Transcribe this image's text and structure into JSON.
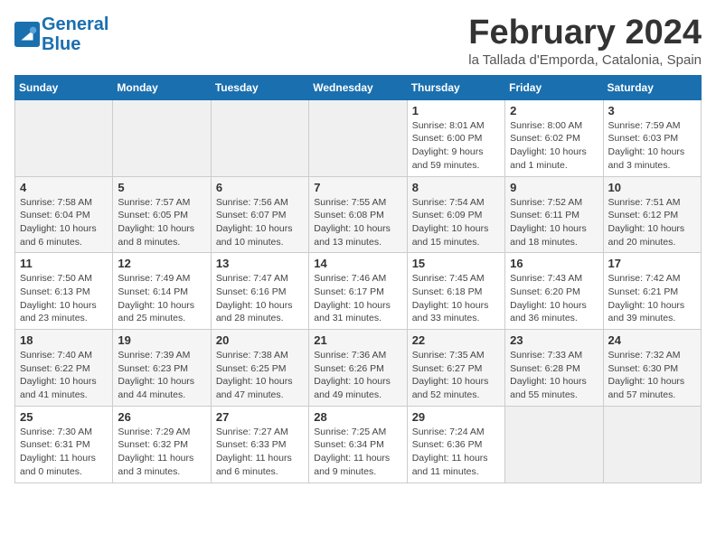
{
  "header": {
    "logo_line1": "General",
    "logo_line2": "Blue",
    "month_title": "February 2024",
    "location": "la Tallada d'Emporda, Catalonia, Spain"
  },
  "weekdays": [
    "Sunday",
    "Monday",
    "Tuesday",
    "Wednesday",
    "Thursday",
    "Friday",
    "Saturday"
  ],
  "weeks": [
    [
      {
        "day": "",
        "info": ""
      },
      {
        "day": "",
        "info": ""
      },
      {
        "day": "",
        "info": ""
      },
      {
        "day": "",
        "info": ""
      },
      {
        "day": "1",
        "info": "Sunrise: 8:01 AM\nSunset: 6:00 PM\nDaylight: 9 hours and 59 minutes."
      },
      {
        "day": "2",
        "info": "Sunrise: 8:00 AM\nSunset: 6:02 PM\nDaylight: 10 hours and 1 minute."
      },
      {
        "day": "3",
        "info": "Sunrise: 7:59 AM\nSunset: 6:03 PM\nDaylight: 10 hours and 3 minutes."
      }
    ],
    [
      {
        "day": "4",
        "info": "Sunrise: 7:58 AM\nSunset: 6:04 PM\nDaylight: 10 hours and 6 minutes."
      },
      {
        "day": "5",
        "info": "Sunrise: 7:57 AM\nSunset: 6:05 PM\nDaylight: 10 hours and 8 minutes."
      },
      {
        "day": "6",
        "info": "Sunrise: 7:56 AM\nSunset: 6:07 PM\nDaylight: 10 hours and 10 minutes."
      },
      {
        "day": "7",
        "info": "Sunrise: 7:55 AM\nSunset: 6:08 PM\nDaylight: 10 hours and 13 minutes."
      },
      {
        "day": "8",
        "info": "Sunrise: 7:54 AM\nSunset: 6:09 PM\nDaylight: 10 hours and 15 minutes."
      },
      {
        "day": "9",
        "info": "Sunrise: 7:52 AM\nSunset: 6:11 PM\nDaylight: 10 hours and 18 minutes."
      },
      {
        "day": "10",
        "info": "Sunrise: 7:51 AM\nSunset: 6:12 PM\nDaylight: 10 hours and 20 minutes."
      }
    ],
    [
      {
        "day": "11",
        "info": "Sunrise: 7:50 AM\nSunset: 6:13 PM\nDaylight: 10 hours and 23 minutes."
      },
      {
        "day": "12",
        "info": "Sunrise: 7:49 AM\nSunset: 6:14 PM\nDaylight: 10 hours and 25 minutes."
      },
      {
        "day": "13",
        "info": "Sunrise: 7:47 AM\nSunset: 6:16 PM\nDaylight: 10 hours and 28 minutes."
      },
      {
        "day": "14",
        "info": "Sunrise: 7:46 AM\nSunset: 6:17 PM\nDaylight: 10 hours and 31 minutes."
      },
      {
        "day": "15",
        "info": "Sunrise: 7:45 AM\nSunset: 6:18 PM\nDaylight: 10 hours and 33 minutes."
      },
      {
        "day": "16",
        "info": "Sunrise: 7:43 AM\nSunset: 6:20 PM\nDaylight: 10 hours and 36 minutes."
      },
      {
        "day": "17",
        "info": "Sunrise: 7:42 AM\nSunset: 6:21 PM\nDaylight: 10 hours and 39 minutes."
      }
    ],
    [
      {
        "day": "18",
        "info": "Sunrise: 7:40 AM\nSunset: 6:22 PM\nDaylight: 10 hours and 41 minutes."
      },
      {
        "day": "19",
        "info": "Sunrise: 7:39 AM\nSunset: 6:23 PM\nDaylight: 10 hours and 44 minutes."
      },
      {
        "day": "20",
        "info": "Sunrise: 7:38 AM\nSunset: 6:25 PM\nDaylight: 10 hours and 47 minutes."
      },
      {
        "day": "21",
        "info": "Sunrise: 7:36 AM\nSunset: 6:26 PM\nDaylight: 10 hours and 49 minutes."
      },
      {
        "day": "22",
        "info": "Sunrise: 7:35 AM\nSunset: 6:27 PM\nDaylight: 10 hours and 52 minutes."
      },
      {
        "day": "23",
        "info": "Sunrise: 7:33 AM\nSunset: 6:28 PM\nDaylight: 10 hours and 55 minutes."
      },
      {
        "day": "24",
        "info": "Sunrise: 7:32 AM\nSunset: 6:30 PM\nDaylight: 10 hours and 57 minutes."
      }
    ],
    [
      {
        "day": "25",
        "info": "Sunrise: 7:30 AM\nSunset: 6:31 PM\nDaylight: 11 hours and 0 minutes."
      },
      {
        "day": "26",
        "info": "Sunrise: 7:29 AM\nSunset: 6:32 PM\nDaylight: 11 hours and 3 minutes."
      },
      {
        "day": "27",
        "info": "Sunrise: 7:27 AM\nSunset: 6:33 PM\nDaylight: 11 hours and 6 minutes."
      },
      {
        "day": "28",
        "info": "Sunrise: 7:25 AM\nSunset: 6:34 PM\nDaylight: 11 hours and 9 minutes."
      },
      {
        "day": "29",
        "info": "Sunrise: 7:24 AM\nSunset: 6:36 PM\nDaylight: 11 hours and 11 minutes."
      },
      {
        "day": "",
        "info": ""
      },
      {
        "day": "",
        "info": ""
      }
    ]
  ]
}
